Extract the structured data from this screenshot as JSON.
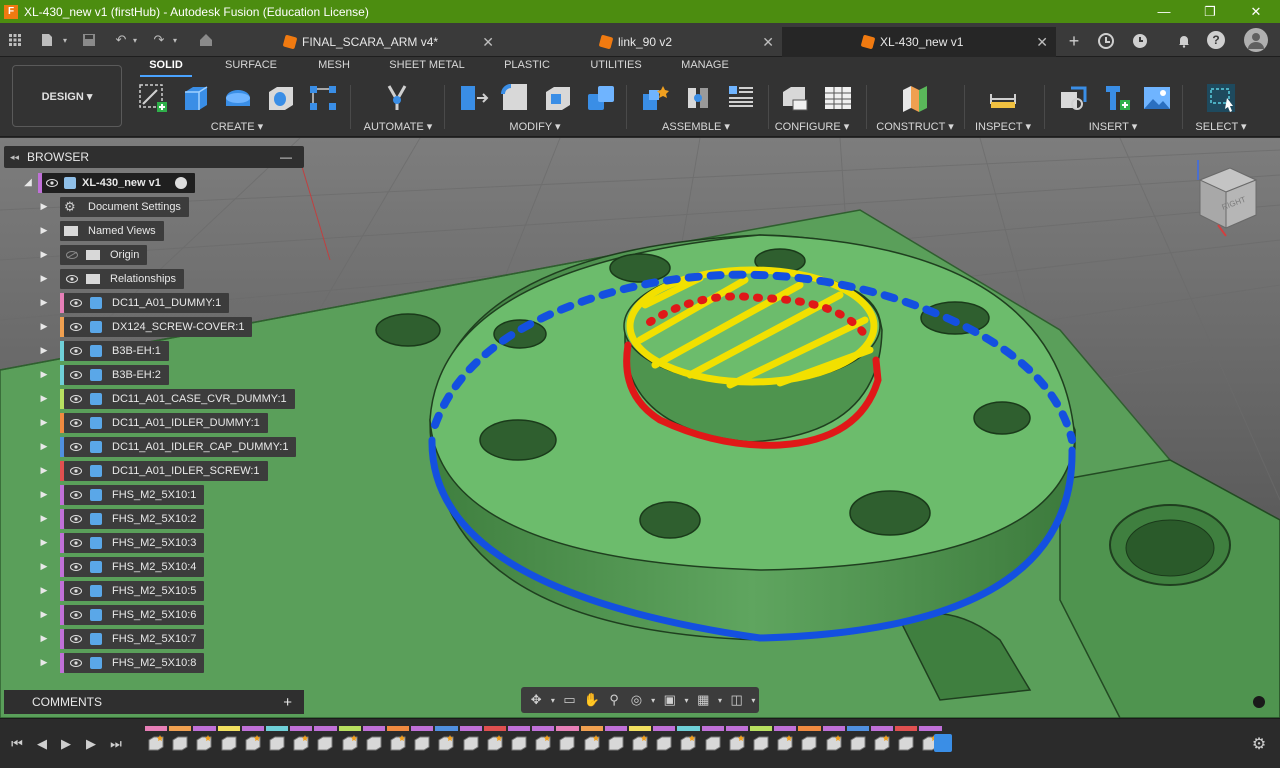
{
  "window": {
    "title": "XL-430_new v1 (firstHub) - Autodesk Fusion (Education License)",
    "app_icon": "F",
    "minimize": "—",
    "maximize": "❐",
    "close": "✕"
  },
  "doc_tabs": [
    {
      "label": "FINAL_SCARA_ARM v4*",
      "active": false
    },
    {
      "label": "link_90 v2",
      "active": false
    },
    {
      "label": "XL-430_new v1",
      "active": true
    }
  ],
  "workspace": {
    "label": "DESIGN ▾"
  },
  "ws_tabs": [
    "SOLID",
    "SURFACE",
    "MESH",
    "SHEET METAL",
    "PLASTIC",
    "UTILITIES",
    "MANAGE"
  ],
  "groups": {
    "create": "CREATE ▾",
    "automate": "AUTOMATE ▾",
    "modify": "MODIFY ▾",
    "assemble": "ASSEMBLE ▾",
    "configure": "CONFIGURE ▾",
    "construct": "CONSTRUCT ▾",
    "inspect": "INSPECT ▾",
    "insert": "INSERT ▾",
    "select": "SELECT ▾"
  },
  "browser": {
    "header": "BROWSER",
    "collapse": "—",
    "root": "XL-430_new v1",
    "items": [
      {
        "label": "Document Settings",
        "color": ""
      },
      {
        "label": "Named Views",
        "color": ""
      },
      {
        "label": "Origin",
        "color": ""
      },
      {
        "label": "Relationships",
        "color": ""
      },
      {
        "label": "DC11_A01_DUMMY:1",
        "color": "#e77fb7"
      },
      {
        "label": "DX124_SCREW-COVER:1",
        "color": "#f0a050"
      },
      {
        "label": "B3B-EH:1",
        "color": "#6fd0d8"
      },
      {
        "label": "B3B-EH:2",
        "color": "#6fd0d8"
      },
      {
        "label": "DC11_A01_CASE_CVR_DUMMY:1",
        "color": "#b8e060"
      },
      {
        "label": "DC11_A01_IDLER_DUMMY:1",
        "color": "#f08a40"
      },
      {
        "label": "DC11_A01_IDLER_CAP_DUMMY:1",
        "color": "#5090e0"
      },
      {
        "label": "DC11_A01_IDLER_SCREW:1",
        "color": "#e05050"
      },
      {
        "label": "FHS_M2_5X10:1",
        "color": "#c070d8"
      },
      {
        "label": "FHS_M2_5X10:2",
        "color": "#c070d8"
      },
      {
        "label": "FHS_M2_5X10:3",
        "color": "#c070d8"
      },
      {
        "label": "FHS_M2_5X10:4",
        "color": "#c070d8"
      },
      {
        "label": "FHS_M2_5X10:5",
        "color": "#c070d8"
      },
      {
        "label": "FHS_M2_5X10:6",
        "color": "#c070d8"
      },
      {
        "label": "FHS_M2_5X10:7",
        "color": "#c070d8"
      },
      {
        "label": "FHS_M2_5X10:8",
        "color": "#c070d8"
      }
    ]
  },
  "comments": {
    "label": "COMMENTS",
    "add": "+"
  },
  "viewcube": {
    "face": "RIGHT"
  },
  "colors": {
    "titlebar": "#4c8d10",
    "model": "#5fae5f",
    "annotation_blue": "#1450e0",
    "annotation_red": "#e01818",
    "annotation_yellow": "#f2e000"
  }
}
